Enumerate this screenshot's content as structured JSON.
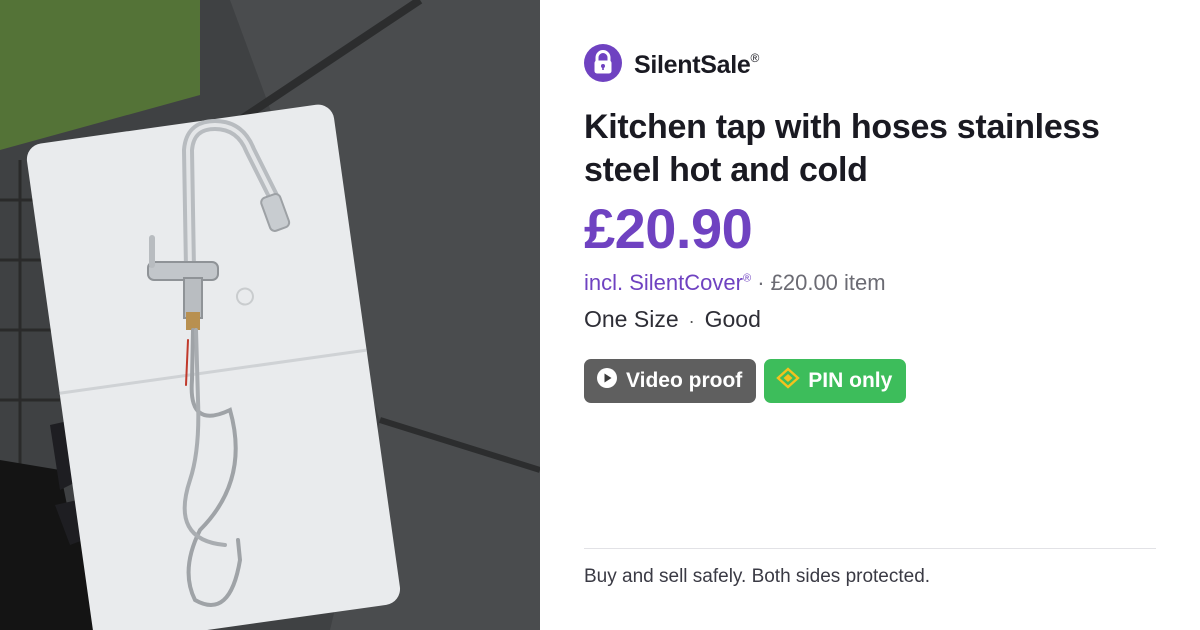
{
  "brand": {
    "name": "SilentSale",
    "reg": "®",
    "accent": "#6f42c1"
  },
  "listing": {
    "title": "Kitchen tap with hoses stainless steel hot and cold",
    "price": "£20.90",
    "cover_label": "incl. SilentCover",
    "cover_reg": "®",
    "item_price": "· £20.00 item",
    "size": "One Size",
    "condition": "Good",
    "separator": "·"
  },
  "badges": {
    "video": {
      "label": "Video proof",
      "icon": "play-icon",
      "color": "#5f5f5f"
    },
    "pin": {
      "label": "PIN only",
      "icon": "diamond-icon",
      "color": "#3dbd5b"
    }
  },
  "footer": {
    "tagline": "Buy and sell safely. Both sides protected."
  }
}
